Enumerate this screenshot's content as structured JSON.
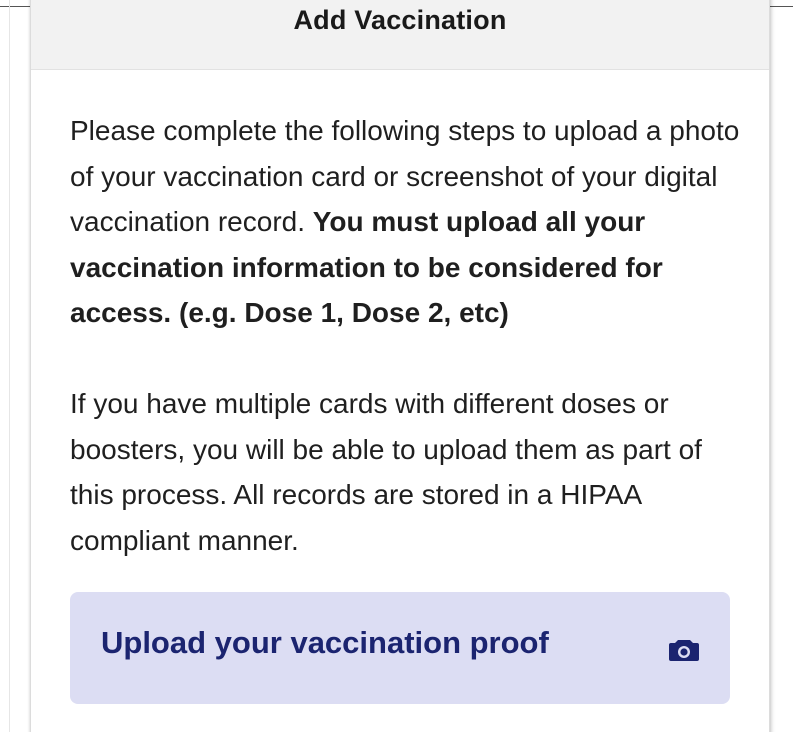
{
  "modal": {
    "title": "Add Vaccination"
  },
  "instructions": {
    "paragraph1_regular": "Please complete the following steps to upload a photo of your vaccination card or screenshot of your digital vaccination record. ",
    "paragraph1_bold": "You must upload all your vaccination information to be considered for access. (e.g. Dose 1, Dose 2, etc)",
    "paragraph2": "If you have multiple cards with different doses or boosters, you will be able to upload them as part of this process. All records are stored in a HIPAA compliant manner."
  },
  "upload": {
    "label": "Upload your vaccination proof",
    "icon": "camera-icon"
  },
  "colors": {
    "button_background": "#dcddf3",
    "button_text": "#1b2470",
    "header_background": "#f2f2f2"
  }
}
